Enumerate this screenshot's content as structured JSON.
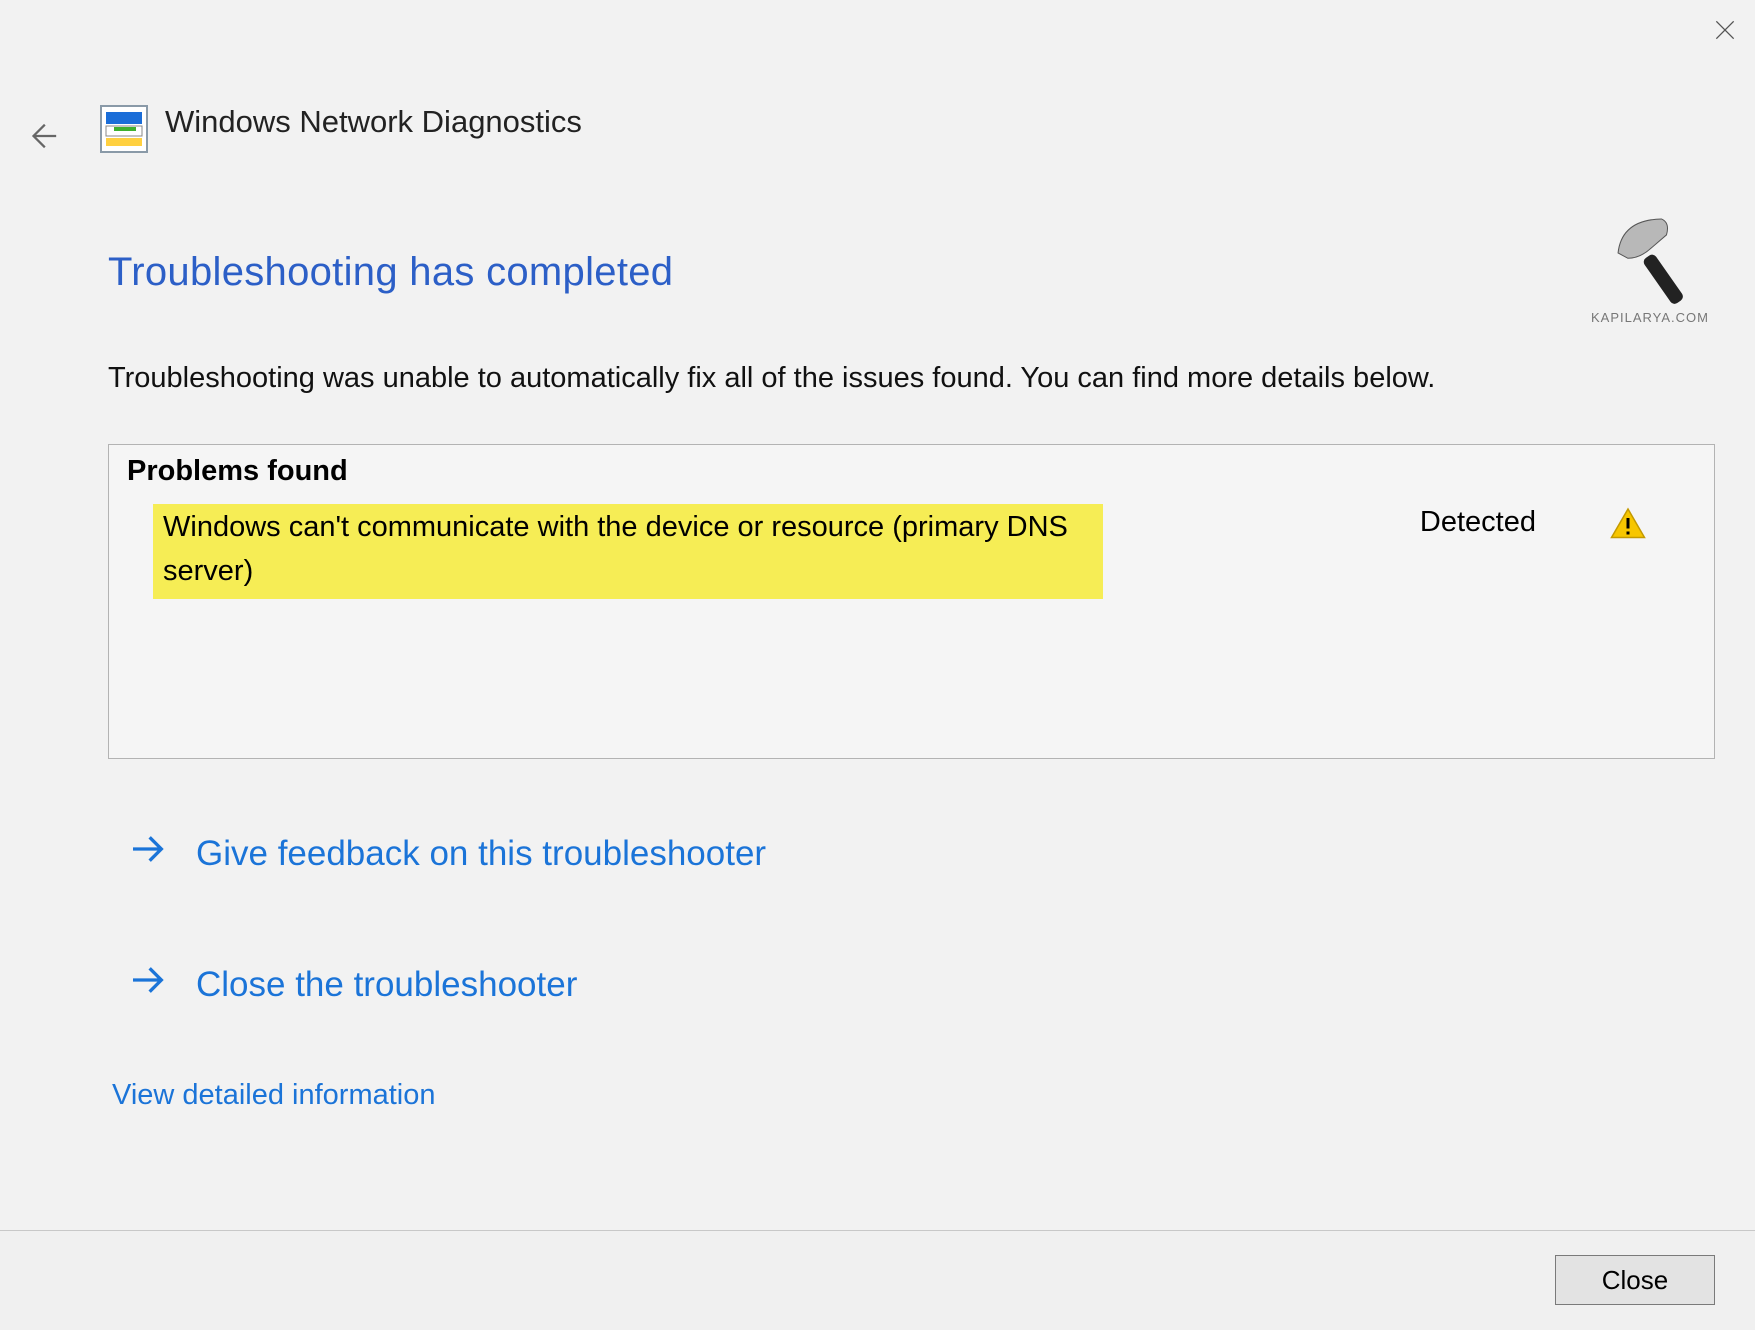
{
  "header": {
    "app_title": "Windows Network Diagnostics"
  },
  "main": {
    "heading": "Troubleshooting has completed",
    "subtext": "Troubleshooting was unable to automatically fix all of the issues found. You can find more details below.",
    "problems_title": "Problems found",
    "problem_text": "Windows can't communicate with the device or resource (primary DNS server)",
    "problem_status": "Detected",
    "action_feedback": "Give feedback on this troubleshooter",
    "action_close": "Close the troubleshooter",
    "detail_link": "View detailed information"
  },
  "watermark": {
    "label": "KAPILARYA.COM"
  },
  "footer": {
    "close_button": "Close"
  }
}
